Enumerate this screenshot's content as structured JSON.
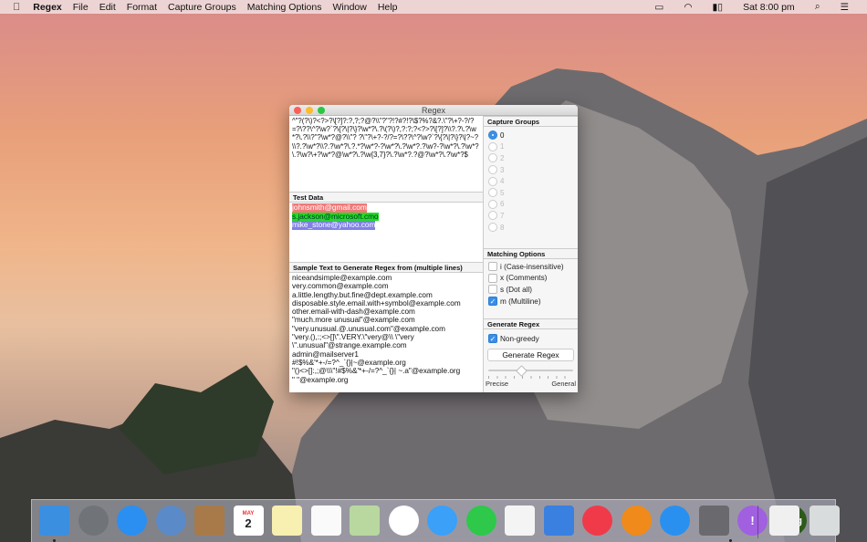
{
  "menubar": {
    "items": [
      "Regex",
      "File",
      "Edit",
      "Format",
      "Capture Groups",
      "Matching Options",
      "Window",
      "Help"
    ],
    "clock": "Sat 8:00 pm"
  },
  "window": {
    "title": "Regex",
    "regex": "^\"?(?\\)?<?>?\\[?]?:?,?;?@?\\\\\"?\"?!?#?!?\\$?%?&?.\\\"?\\+?-?/?=?\\??\\^?\\w?`?\\{?\\|?\\}?\\w*?\\.?\\(?\\)?,?:?;?<?>?\\[?]?\\\\?.?\\.?\\w*?\\.?\\\\?\"?\\w*?@?\\\\\"? ?\\\"?\\+?-?/?=?\\??\\^?\\w?`?\\{?\\|?\\}?\\|?~?\\\\?.?\\w*?\\\\?.?\\w*?\\.?.*?\\w*?-?\\w*?\\.?\\w*?.?\\w?-?\\w*?\\.?\\w*?\\.?\\w?\\+?\\w*?@\\w*?\\.?\\w{3,7}?\\.?\\w*?.?@?\\w*?\\.?\\w*?$",
    "test_header": "Test Data",
    "test_data": [
      {
        "text": "johnsmith@gmail.com",
        "color": "#f07878"
      },
      {
        "text": "s.jackson@microsoft.cmo",
        "color": "#22dd22"
      },
      {
        "text": "mike_stone@yahoo.com",
        "color": "#8080e8"
      }
    ],
    "sample_header": "Sample Text to Generate Regex from (multiple lines)",
    "sample_lines": [
      "niceandsimple@example.com",
      "very.common@example.com",
      "a.little.lengthy.but.fine@dept.example.com",
      "disposable.style.email.with+symbol@example.com",
      "other.email-with-dash@example.com",
      "\"much.more unusual\"@example.com",
      "\"very.unusual.@.unusual.com\"@example.com",
      "\"very.(),:;<>[]\\\".VERY.\\\"very@\\\\ \\\"very",
      "\\\".unusual\"@strange.example.com",
      "admin@mailserver1",
      "#!$%&'*+-/=?^_`{}|~@example.org",
      "\"()<>[]:,;@\\\\\\\"!#$%&'*+-/=?^_`{}| ~.a\"@example.org",
      "\" \"@example.org"
    ],
    "capture_groups": {
      "header": "Capture Groups",
      "options": [
        "0",
        "1",
        "2",
        "3",
        "4",
        "5",
        "6",
        "7",
        "8"
      ],
      "selected": "0"
    },
    "matching_options": {
      "header": "Matching Options",
      "items": [
        {
          "label": "i (Case-insensitive)",
          "checked": false
        },
        {
          "label": "x (Comments)",
          "checked": false
        },
        {
          "label": "s (Dot all)",
          "checked": false
        },
        {
          "label": "m (Multiline)",
          "checked": true
        }
      ]
    },
    "generate": {
      "header": "Generate Regex",
      "non_greedy": "Non-greedy",
      "button": "Generate Regex",
      "slider_min": "Precise",
      "slider_max": "General",
      "slider_value": 0.38
    }
  },
  "dock": {
    "apps": [
      "finder",
      "launchpad",
      "safari",
      "mail",
      "contacts",
      "calendar",
      "notes",
      "reminders",
      "maps",
      "photos",
      "messages",
      "facetime",
      "numbers",
      "keynote",
      "itunes",
      "ibooks",
      "app-store",
      "system-preferences",
      "feedback",
      "regex",
      "pdf",
      "trash"
    ],
    "calendar_month": "MAY",
    "calendar_day": "2",
    "regex_label": "Re/g"
  }
}
